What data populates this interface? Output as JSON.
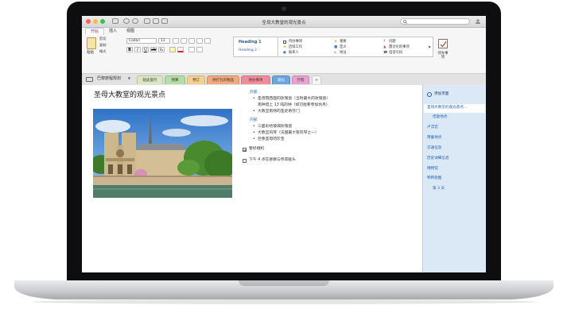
{
  "window": {
    "title": "圣母大教堂的观光景点"
  },
  "ribbon": {
    "tabs": [
      "开始",
      "插入",
      "视图"
    ],
    "clipboard": {
      "paste": "粘贴",
      "cut": "剪切",
      "copy": "复制",
      "format": "格式"
    },
    "font": {
      "name": "Calibri",
      "size": "11"
    },
    "styles": [
      "Heading 1",
      "Heading 2"
    ],
    "tags": [
      "待办事项",
      "重要",
      "问题",
      "后续工作",
      "定义",
      "需讨论的事项",
      "联系人",
      "地址",
      "电话号码"
    ],
    "todo_button": "待办事项"
  },
  "notebook": {
    "name": "巴黎旅程规划"
  },
  "sections": [
    {
      "label": "短途旅行",
      "color": "#d9e7c3"
    },
    {
      "label": "预算",
      "color": "#b6dca6"
    },
    {
      "label": "预订",
      "color": "#f5d08f"
    },
    {
      "label": "待打包的物品",
      "color": "#f2aa7d"
    },
    {
      "label": "待办事项",
      "color": "#f08c99"
    },
    {
      "label": "观光",
      "color": "#89b9e4"
    },
    {
      "label": "行程",
      "color": "#e8a3cf"
    }
  ],
  "add_section": "+",
  "page": {
    "title": "圣母大教堂的观光景点",
    "outside_heading": "外部",
    "outside_items": [
      "圣母院西面的玫瑰窗（当时最大的玫瑰窗）",
      "南钟塔上 13 吨的钟（如可能要参加仿吊）",
      "大教堂南侧的圣史蒂芬门"
    ],
    "inside_heading": "内部",
    "inside_items": [
      "三面彩绘玻璃玫瑰窗",
      "大教堂风琴（法国最大管风琴之一）",
      "巨像圣母的珍宝"
    ],
    "todo_1": {
      "text": "整好相机",
      "checked": true
    },
    "todo_2": {
      "text": "下午 4 点在德穆与传岸碰头",
      "checked": false
    }
  },
  "pagelist": {
    "add_page": "添加页面",
    "pages": [
      "圣母大教堂的观光景点...",
      "佳歌地点",
      "卢浮宫",
      "用餐地点",
      "交通信息",
      "历史详细信息",
      "博物馆",
      "鸭鸭街图",
      "第 3 天"
    ],
    "selected_index": 0
  },
  "colors": {
    "accent": "#7a3c8c",
    "heading_blue": "#2e6fb4",
    "pagelist_bg": "#dbe9f6"
  }
}
